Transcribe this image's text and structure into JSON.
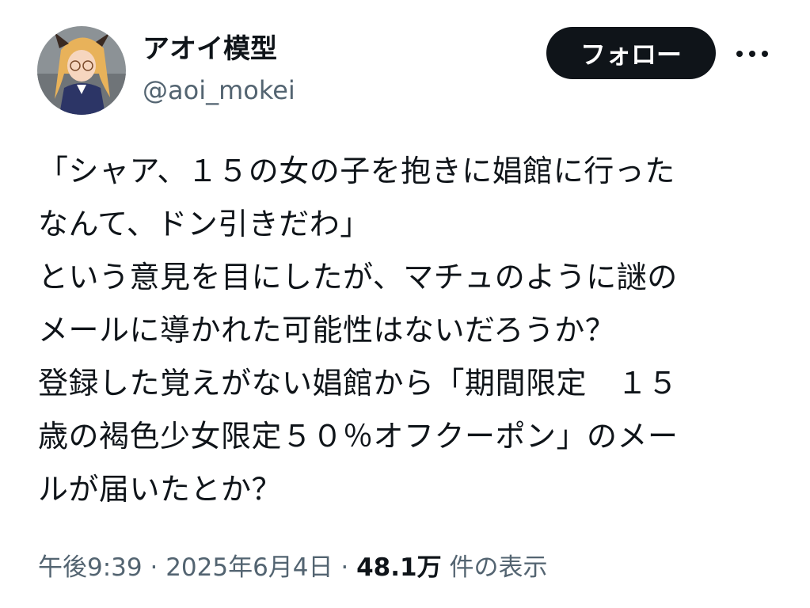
{
  "author": {
    "display_name": "アオイ模型",
    "handle": "@aoi_mokei",
    "avatar_icon": "avatar-figure-icon"
  },
  "actions": {
    "follow_label": "フォロー",
    "more_icon": "more-horizontal-icon"
  },
  "tweet": {
    "lines": [
      "「シャア、１５の女の子を抱きに娼館に行った",
      "なんて、ドン引きだわ」",
      "という意見を目にしたが、マチュのように謎の",
      "メールに導かれた可能性はないだろうか？",
      "登録した覚えがない娼館から「期間限定　１５",
      "歳の褐色少女限定５０％オフクーポン」のメー",
      "ルが届いたとか？"
    ]
  },
  "meta": {
    "time": "午後9:39",
    "sep1": " · ",
    "date": "2025年6月4日",
    "sep2": " · ",
    "views_count": "48.1万",
    "views_label": " 件の表示"
  },
  "colors": {
    "text": "#0f1419",
    "secondary": "#536471",
    "button_bg": "#0f1419",
    "button_text": "#ffffff"
  }
}
